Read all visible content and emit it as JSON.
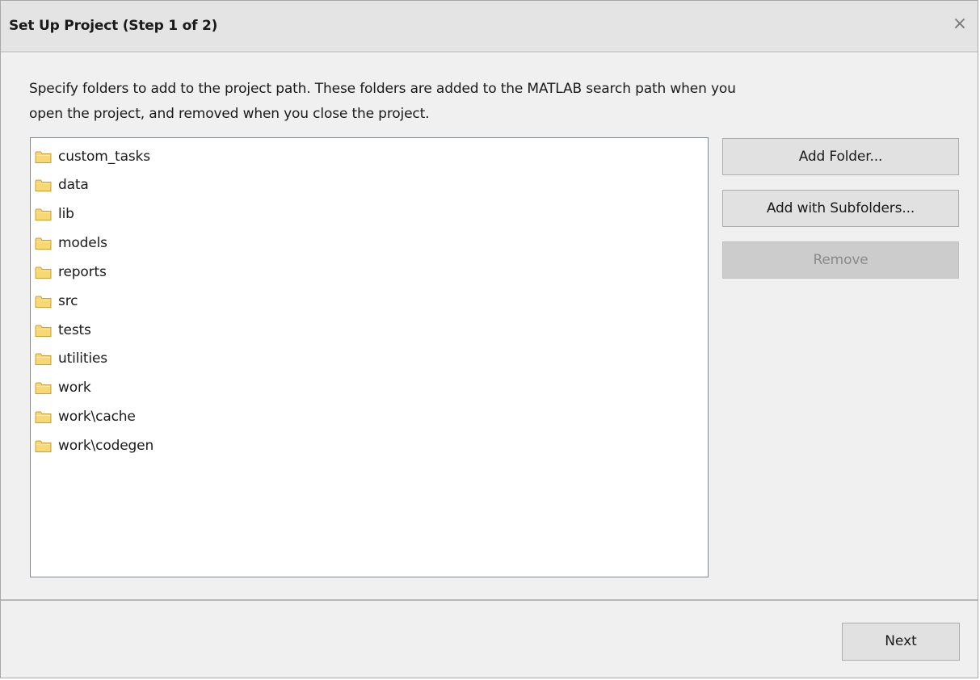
{
  "dialog": {
    "title": "Set Up Project (Step 1 of 2)",
    "close_glyph": "×",
    "description_line1": "Specify folders to add to the project path. These folders are added to the MATLAB search path when you",
    "description_line2": "open the project, and removed when you close the project."
  },
  "folders": {
    "icon": "folder-icon",
    "items": [
      {
        "label": "custom_tasks"
      },
      {
        "label": "data"
      },
      {
        "label": "lib"
      },
      {
        "label": "models"
      },
      {
        "label": "reports"
      },
      {
        "label": "src"
      },
      {
        "label": "tests"
      },
      {
        "label": "utilities"
      },
      {
        "label": "work"
      },
      {
        "label": "work\\cache"
      },
      {
        "label": "work\\codegen"
      }
    ]
  },
  "buttons": {
    "add_folder": "Add Folder...",
    "add_with_subfolders": "Add with Subfolders...",
    "remove": "Remove",
    "next": "Next"
  },
  "colors": {
    "folder_fill": "#f8d775",
    "folder_stroke": "#c9a033",
    "disabled_button": "#cccccc"
  }
}
